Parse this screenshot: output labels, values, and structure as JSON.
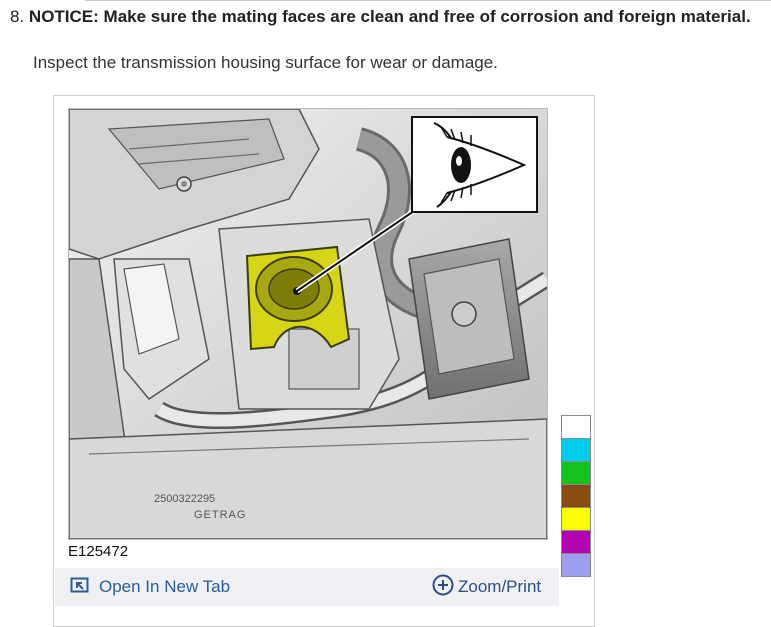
{
  "step": {
    "number": "8.",
    "notice": "NOTICE: Make sure the mating faces are clean and free of corrosion and foreign material.",
    "instruction": "Inspect the transmission housing surface for wear or damage."
  },
  "figure": {
    "id": "E125472",
    "casting_text_1": "2500322295",
    "casting_text_2": "GETRAG",
    "open_in_new_tab": "Open In New Tab",
    "zoom_print": "Zoom/Print"
  },
  "color_key": [
    "#ffffff",
    "#00ccf0",
    "#14c21f",
    "#8b4a10",
    "#ffff00",
    "#b400b4",
    "#9e9ef0"
  ],
  "colors": {
    "highlight": "#d6d616",
    "link": "#2b5d9a"
  }
}
